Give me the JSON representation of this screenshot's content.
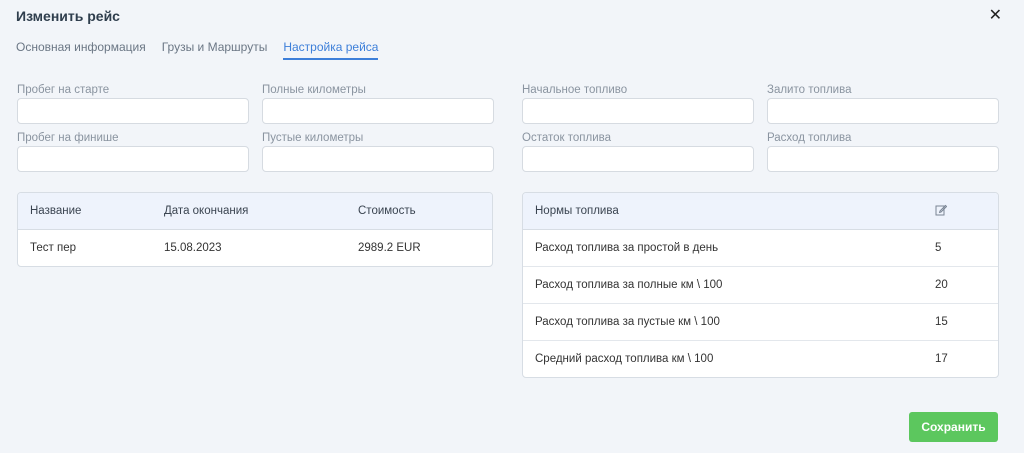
{
  "dialog": {
    "title": "Изменить рейс",
    "close_label": "✕"
  },
  "tabs": [
    {
      "label": "Основная информация",
      "active": false
    },
    {
      "label": "Грузы и Маршруты",
      "active": false
    },
    {
      "label": "Настройка рейса",
      "active": true
    }
  ],
  "fields": {
    "start_mileage": {
      "label": "Пробег на старте",
      "value": ""
    },
    "full_km": {
      "label": "Полные километры",
      "value": ""
    },
    "finish_mileage": {
      "label": "Пробег на финише",
      "value": ""
    },
    "empty_km": {
      "label": "Пустые километры",
      "value": ""
    },
    "initial_fuel": {
      "label": "Начальное топливо",
      "value": ""
    },
    "fueled": {
      "label": "Залито топлива",
      "value": ""
    },
    "fuel_remaining": {
      "label": "Остаток топлива",
      "value": ""
    },
    "fuel_consumption": {
      "label": "Расход топлива",
      "value": ""
    }
  },
  "costs_table": {
    "headers": [
      "Название",
      "Дата окончания",
      "Стоимость"
    ],
    "rows": [
      {
        "name": "Тест пер",
        "end_date": "15.08.2023",
        "cost": "2989.2 EUR"
      }
    ]
  },
  "fuel_norms": {
    "header": "Нормы топлива",
    "edit_icon": "edit-icon",
    "rows": [
      {
        "label": "Расход топлива за простой в день",
        "value": "5"
      },
      {
        "label": "Расход топлива за полные км \\ 100",
        "value": "20"
      },
      {
        "label": "Расход топлива за пустые км \\ 100",
        "value": "15"
      },
      {
        "label": "Средний расход топлива км \\ 100",
        "value": "17"
      }
    ]
  },
  "actions": {
    "save_label": "Сохранить",
    "save_color": "#5cc75e"
  },
  "colors": {
    "accent": "#3d7fd9",
    "background": "#f2f5f9",
    "table_header": "#eef3fc"
  }
}
